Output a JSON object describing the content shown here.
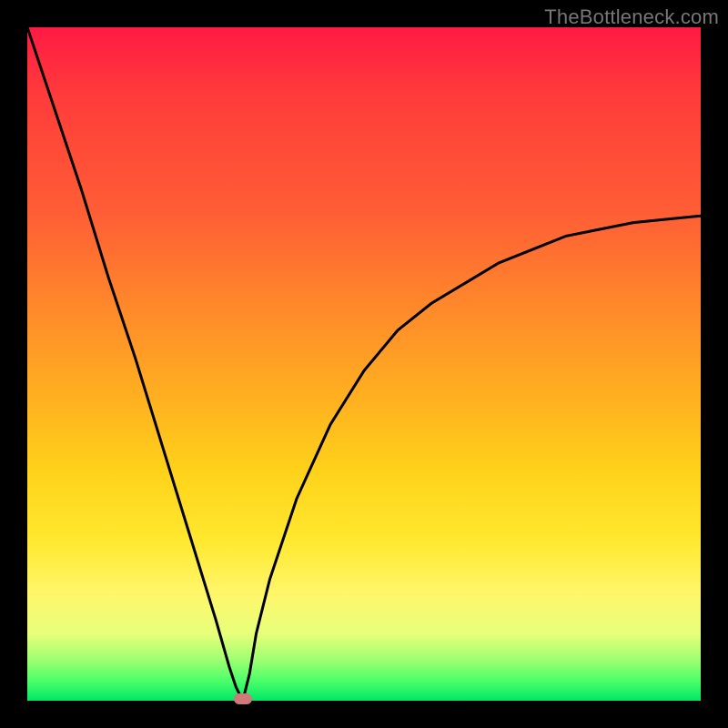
{
  "watermark": "TheBottleneck.com",
  "colors": {
    "frame": "#000000",
    "curve": "#000000",
    "marker": "#cf7a78",
    "gradient_stops": [
      "#ff1a44",
      "#ff3b3b",
      "#ff5f35",
      "#ff8a2a",
      "#ffb020",
      "#ffd21a",
      "#ffe82e",
      "#fff66a",
      "#e8ff7a",
      "#9dff70",
      "#4dff6a",
      "#00e765"
    ]
  },
  "chart_data": {
    "type": "line",
    "title": "",
    "xlabel": "",
    "ylabel": "",
    "xlim": [
      0,
      100
    ],
    "ylim": [
      0,
      100
    ],
    "grid": false,
    "legend": false,
    "description": "Single V-shaped curve with minimum near x≈32 at y≈0; left branch steep, right branch rises with diminishing slope toward ~72 at x=100. Background heatmap gradient from red (top/high y) to green (bottom/low y).",
    "series": [
      {
        "name": "curve",
        "x": [
          0,
          4,
          8,
          12,
          16,
          20,
          24,
          28,
          30,
          31,
          32,
          33,
          34,
          36,
          40,
          45,
          50,
          55,
          60,
          65,
          70,
          75,
          80,
          85,
          90,
          95,
          100
        ],
        "y": [
          100,
          88,
          76,
          63,
          51,
          38,
          25,
          12,
          5,
          2,
          0,
          4,
          10,
          18,
          30,
          41,
          49,
          55,
          59,
          62,
          65,
          67,
          69,
          70,
          71,
          71.5,
          72
        ]
      }
    ],
    "marker": {
      "x": 32,
      "y": 0
    }
  }
}
